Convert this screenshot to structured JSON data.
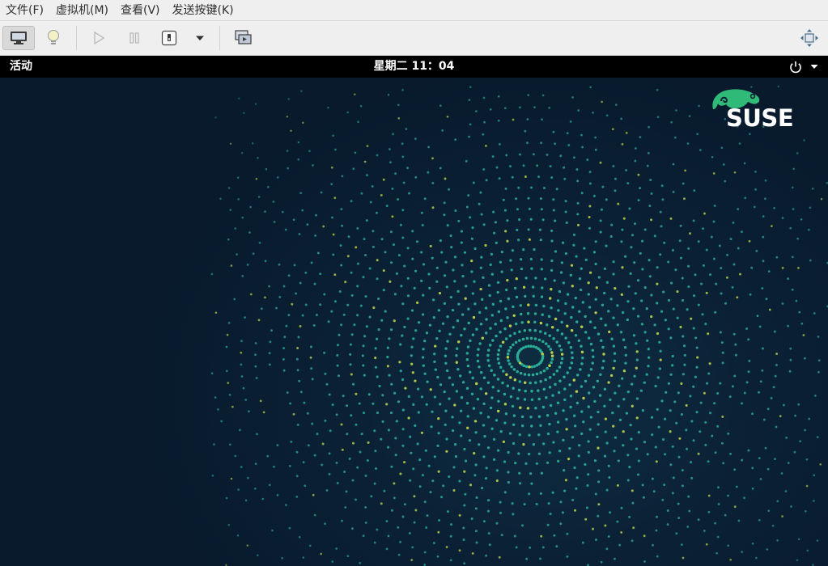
{
  "menubar": {
    "items": [
      {
        "label": "文件(F)"
      },
      {
        "label": "虚拟机(M)"
      },
      {
        "label": "查看(V)"
      },
      {
        "label": "发送按键(K)"
      }
    ]
  },
  "toolbar": {
    "buttons": [
      {
        "icon": "monitor-icon",
        "active": true
      },
      {
        "icon": "lightbulb-icon"
      },
      {
        "icon": "play-icon"
      },
      {
        "icon": "pause-icon"
      },
      {
        "icon": "power-icon"
      },
      {
        "icon": "dropdown-arrow-icon"
      },
      {
        "icon": "snapshot-icon"
      },
      {
        "icon": "fullscreen-icon"
      }
    ]
  },
  "guest": {
    "topbar": {
      "activities": "活动",
      "clock": "星期二 11：04"
    },
    "logo_text": "SUSE",
    "colors": {
      "brand_green": "#30ba78",
      "background": "#0b1d33",
      "dots_teal": "#2bb39a",
      "dots_yellow": "#c4d94c"
    }
  }
}
